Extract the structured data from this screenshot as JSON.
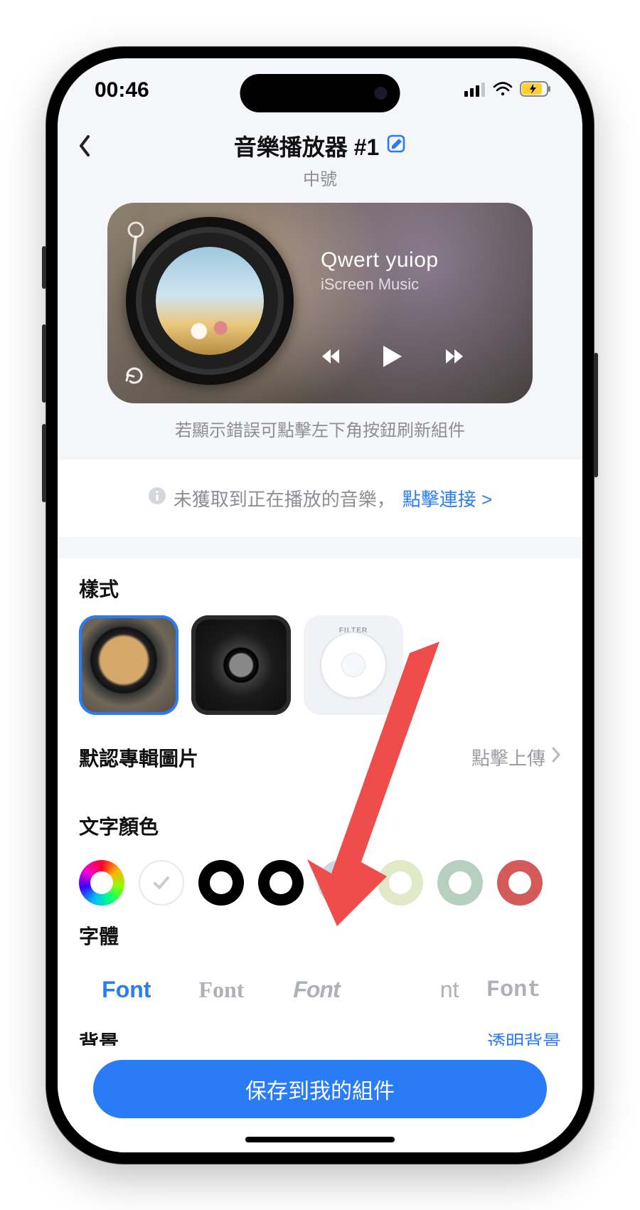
{
  "status": {
    "time": "00:46"
  },
  "header": {
    "title": "音樂播放器 #1",
    "subtitle": "中號"
  },
  "preview": {
    "track_title": "Qwert yuiop",
    "track_subtitle": "iScreen Music",
    "hint": "若顯示錯誤可點擊左下角按鈕刷新組件"
  },
  "notice": {
    "text": "未獲取到正在播放的音樂，",
    "link": "點擊連接 >"
  },
  "sections": {
    "style_title": "樣式",
    "album_row": {
      "label": "默認專輯圖片",
      "action": "點擊上傳"
    },
    "text_color_title": "文字顏色",
    "colors": [
      "rainbow",
      "#ffffff",
      "#000000",
      "#000000",
      "#cdd6e5",
      "#e2e9c7",
      "#b6cfc0",
      "#d35a58"
    ],
    "font_title": "字體",
    "fonts": [
      "Font",
      "Font",
      "Font",
      "nt",
      "Font"
    ],
    "background_title": "背景",
    "background_link": "透明背景",
    "backgrounds": [
      "#e8ebf1",
      "#e8ebf1",
      "linear-gradient(135deg,#3b6bff,#a84bff)",
      "#ffffff",
      "#1c1c1c",
      "#1c1c1c",
      "#e8ebf1"
    ]
  },
  "save_button": "保存到我的組件",
  "ipod_label": "FILTER"
}
